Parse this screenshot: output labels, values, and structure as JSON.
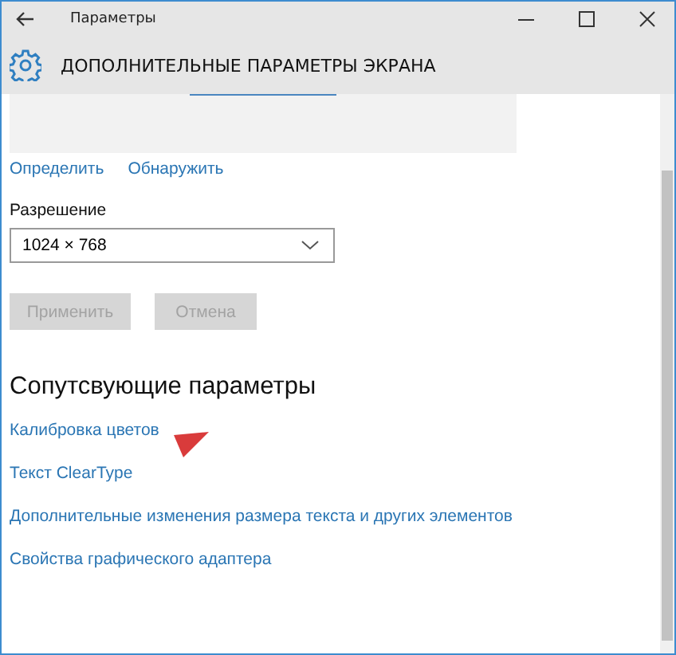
{
  "window": {
    "title": "Параметры"
  },
  "header": {
    "title": "ДОПОЛНИТЕЛЬНЫЕ ПАРАМЕТРЫ ЭКРАНА"
  },
  "display_links": [
    "Определить",
    "Обнаружить"
  ],
  "resolution": {
    "label": "Разрешение",
    "value": "1024 × 768"
  },
  "buttons": [
    {
      "label": "Применить",
      "disabled": true
    },
    {
      "label": "Отмена",
      "disabled": true
    }
  ],
  "related": {
    "title": "Сопутсвующие параметры",
    "links": [
      "Калибровка цветов",
      "Текст ClearType",
      "Дополнительные изменения размера текста и других элементов",
      "Свойства графического адаптера"
    ]
  }
}
